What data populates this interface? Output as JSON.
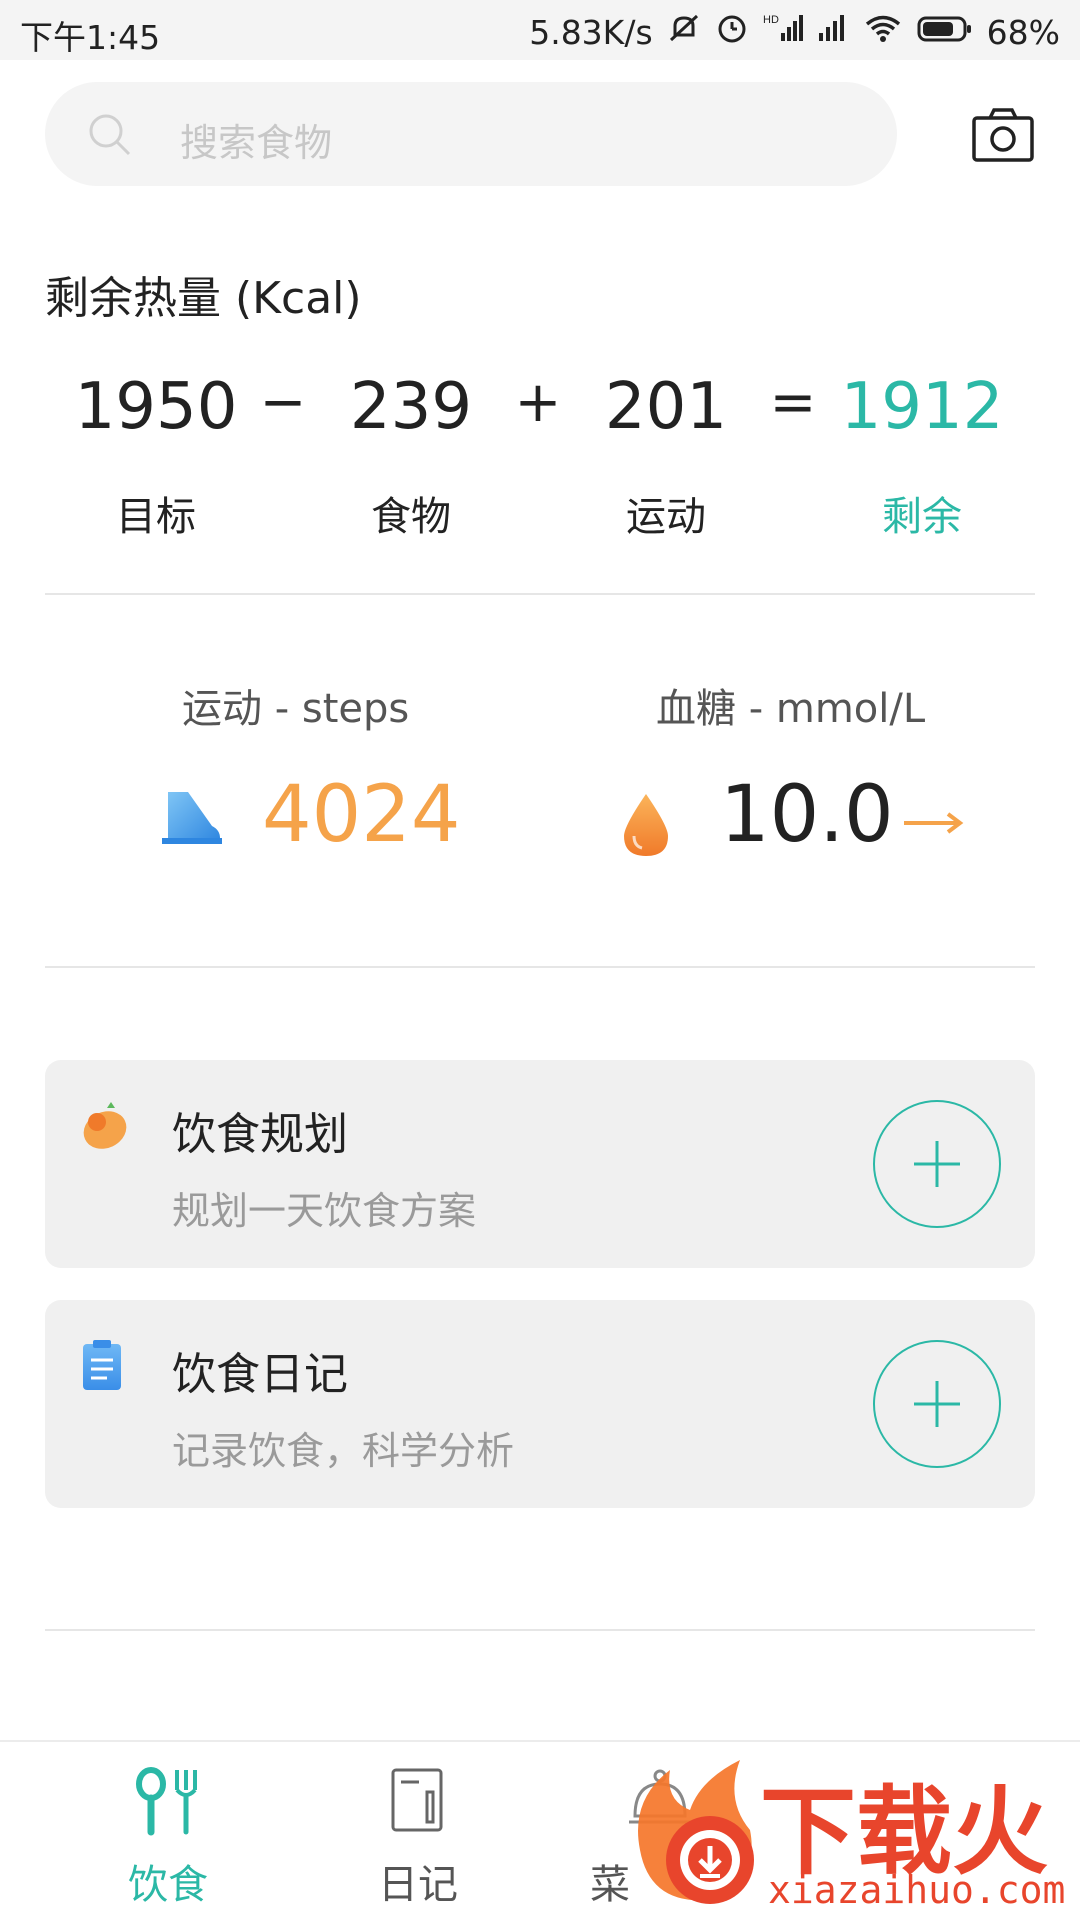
{
  "status_bar": {
    "time": "下午1:45",
    "speed": "5.83K/s",
    "battery": "68%"
  },
  "search": {
    "placeholder": "搜索食物",
    "icon": "search-icon"
  },
  "camera_icon": "camera-icon",
  "calories": {
    "title": "剩余热量 (Kcal)",
    "goal": {
      "value": "1950",
      "label": "目标"
    },
    "op1": "−",
    "food": {
      "value": "239",
      "label": "食物"
    },
    "op2": "+",
    "exercise": {
      "value": "201",
      "label": "运动"
    },
    "op3": "=",
    "remaining": {
      "value": "1912",
      "label": "剩余"
    }
  },
  "metrics": {
    "steps": {
      "label": "运动 - steps",
      "value": "4024",
      "icon": "shoe-icon",
      "color": "#f5a34a"
    },
    "glucose": {
      "label": "血糖 - mmol/L",
      "value": "10.0",
      "icon": "drop-icon",
      "trend_icon": "arrow-right-icon"
    }
  },
  "cards": [
    {
      "title": "饮食规划",
      "subtitle": "规划一天饮食方案",
      "icon": "food-plan-icon"
    },
    {
      "title": "饮食日记",
      "subtitle": "记录饮食，科学分析",
      "icon": "clipboard-icon"
    }
  ],
  "tabs": [
    {
      "label": "饮食",
      "icon": "utensils-icon",
      "active": true
    },
    {
      "label": "日记",
      "icon": "notebook-icon",
      "active": false
    },
    {
      "label": "菜",
      "icon": "dish-icon",
      "active": false
    }
  ],
  "watermark": {
    "text": "下载火",
    "domain": "xiazaihuo.com"
  },
  "colors": {
    "accent": "#2bb8a6",
    "orange": "#f5a34a",
    "text": "#222222",
    "muted": "#9a9a9a"
  }
}
